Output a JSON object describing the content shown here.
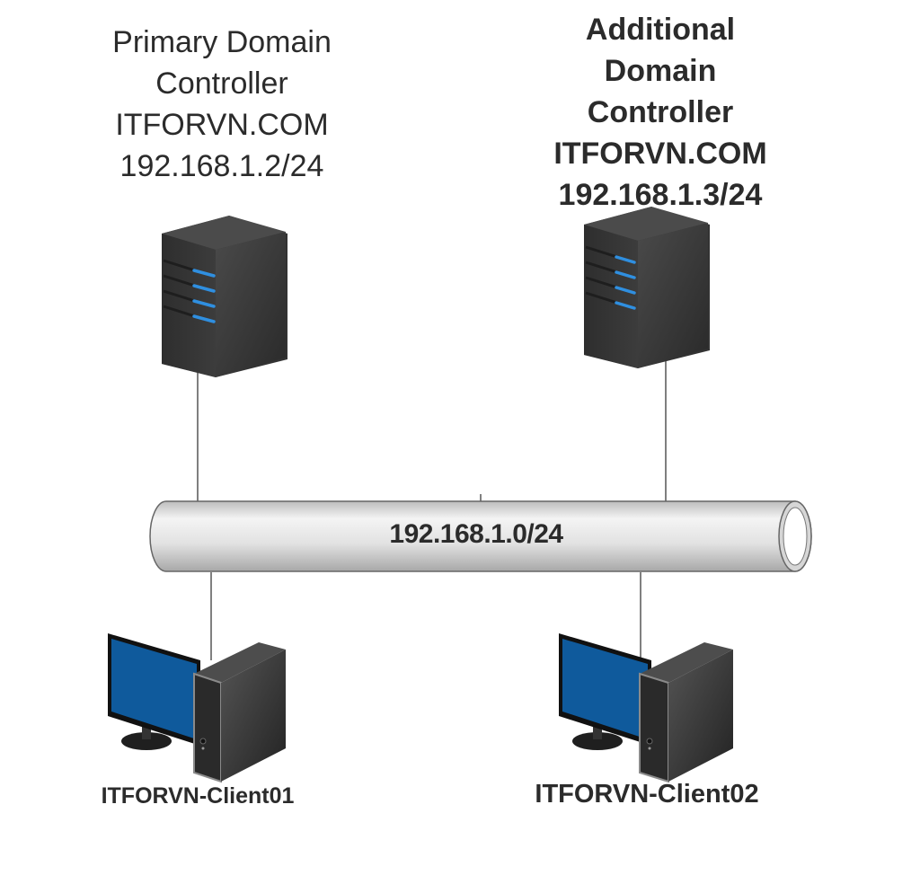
{
  "primary_dc": {
    "lines": [
      "Primary Domain",
      "Controller",
      "ITFORVN.COM",
      "192.168.1.2/24"
    ],
    "icon": "server-tower-icon"
  },
  "additional_dc": {
    "lines": [
      "Additional",
      "Domain",
      "Controller",
      "ITFORVN.COM",
      "192.168.1.3/24"
    ],
    "icon": "server-tower-icon"
  },
  "network": {
    "label": "192.168.1.0/24",
    "icon": "network-pipe"
  },
  "clients": [
    {
      "name": "ITFORVN-Client01",
      "icon": "desktop-computer-icon"
    },
    {
      "name": "ITFORVN-Client02",
      "icon": "desktop-computer-icon"
    }
  ],
  "colors": {
    "server_body": "#3a3a3a",
    "server_led": "#2f8fe0",
    "monitor_screen": "#0f5a9c",
    "pipe": "#dcdcdc",
    "text": "#2b2b2b"
  }
}
